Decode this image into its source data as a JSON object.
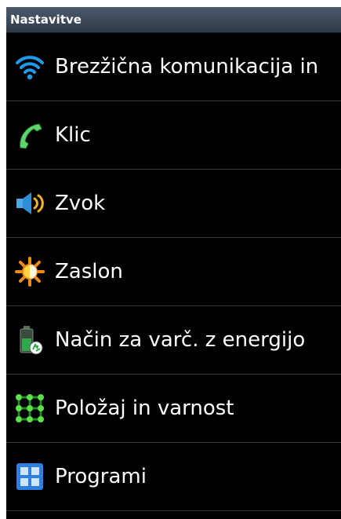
{
  "header": {
    "title": "Nastavitve"
  },
  "items": [
    {
      "label": "Brezžična komunikacija in",
      "icon": "wifi-icon"
    },
    {
      "label": "Klic",
      "icon": "phone-call-icon"
    },
    {
      "label": "Zvok",
      "icon": "speaker-icon"
    },
    {
      "label": "Zaslon",
      "icon": "brightness-icon"
    },
    {
      "label": "Način za varč. z energijo",
      "icon": "battery-recycle-icon"
    },
    {
      "label": "Položaj in varnost",
      "icon": "location-security-icon"
    },
    {
      "label": "Programi",
      "icon": "applications-icon"
    }
  ]
}
